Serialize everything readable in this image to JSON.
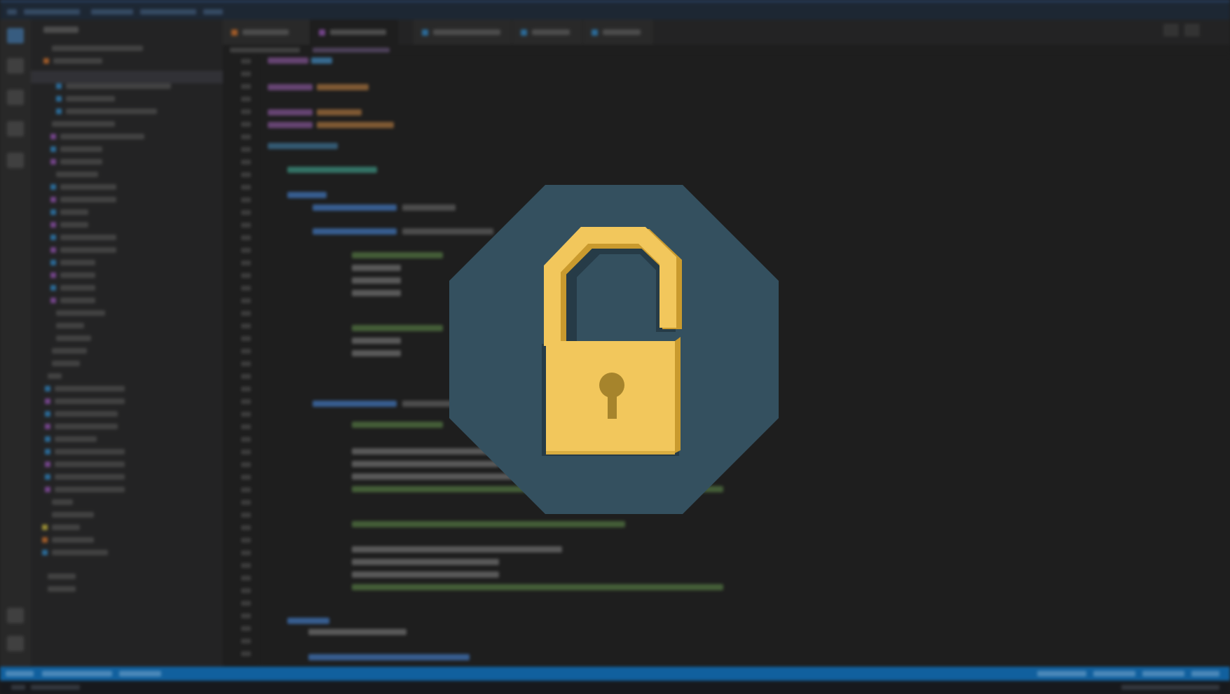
{
  "window": {
    "theme": "dark code editor (blurred)",
    "accent_color": "#0e73c2"
  },
  "overlay": {
    "icon": "unlocked-padlock-icon",
    "badge_shape": "octagon",
    "badge_color": "#34505f",
    "lock_color": "#f2c75c",
    "lock_shadow_color": "#c99a2e",
    "keyhole_color": "#a6842c"
  }
}
